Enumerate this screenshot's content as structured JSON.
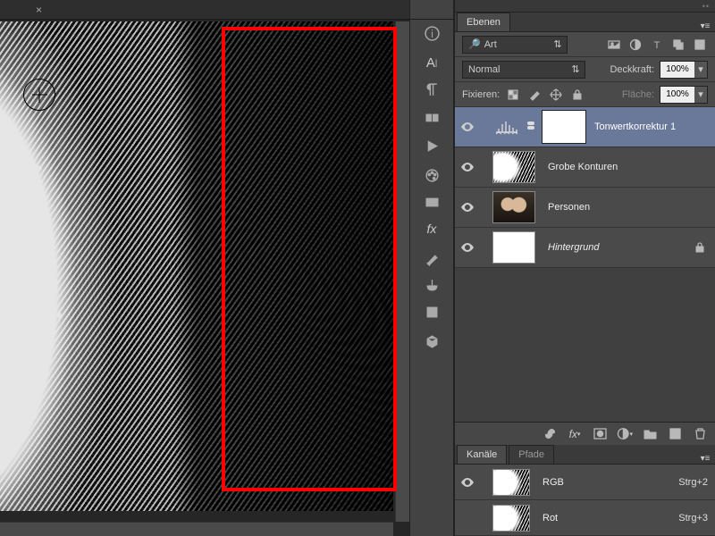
{
  "panel": {
    "layers_tab": "Ebenen",
    "channels_tab": "Kanäle",
    "paths_tab": "Pfade"
  },
  "filter": {
    "label": "Art"
  },
  "blend": {
    "mode": "Normal",
    "opacity_label": "Deckkraft:",
    "opacity_val": "100%",
    "lock_label": "Fixieren:",
    "fill_label": "Fläche:",
    "fill_val": "100%"
  },
  "layers": [
    {
      "name": "Tonwertkorrektur 1"
    },
    {
      "name": "Grobe Konturen"
    },
    {
      "name": "Personen"
    },
    {
      "name": "Hintergrund"
    }
  ],
  "channels": [
    {
      "name": "RGB",
      "shortcut": "Strg+2"
    },
    {
      "name": "Rot",
      "shortcut": "Strg+3"
    }
  ]
}
